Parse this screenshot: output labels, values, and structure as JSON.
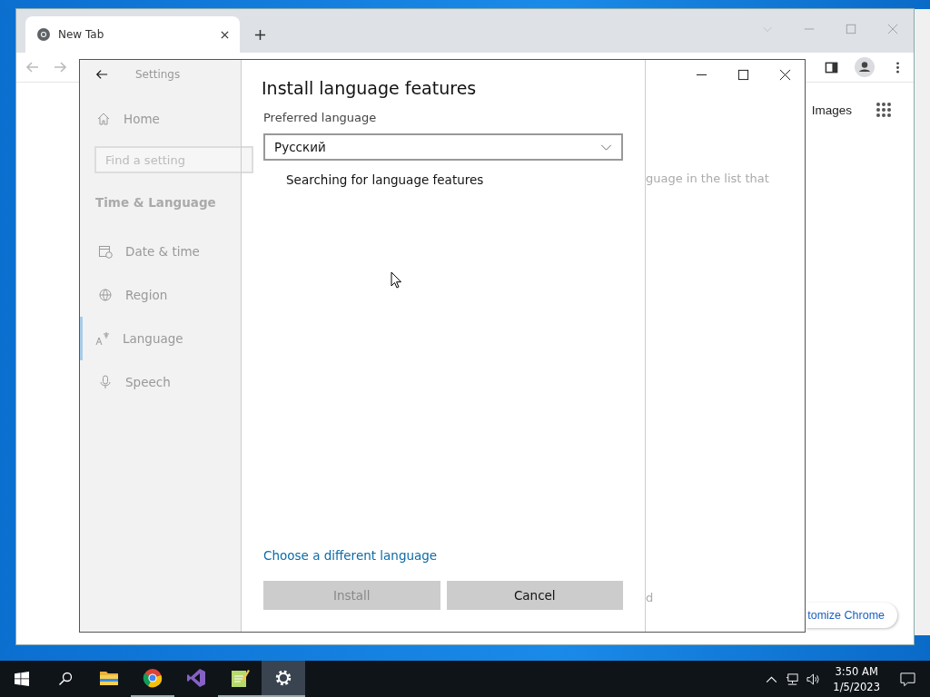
{
  "browser": {
    "tab": {
      "title": "New Tab"
    },
    "page": {
      "images_link": "Images",
      "customize_button": "tomize Chrome"
    }
  },
  "settings": {
    "title": "Settings",
    "home": "Home",
    "search": {
      "placeholder": "Find a setting"
    },
    "section": "Time & Language",
    "nav": [
      {
        "label": "Date & time",
        "selected": false
      },
      {
        "label": "Region",
        "selected": false
      },
      {
        "label": "Language",
        "selected": true
      },
      {
        "label": "Speech",
        "selected": false
      }
    ],
    "background_text": [
      "guage in the list that",
      "d"
    ]
  },
  "dialog": {
    "title": "Install language features",
    "field_label": "Preferred language",
    "language": {
      "value": "Русский"
    },
    "status": "Searching for language features",
    "link": "Choose a different language",
    "buttons": [
      {
        "label": "Install",
        "disabled": true
      },
      {
        "label": "Cancel",
        "disabled": false
      }
    ]
  },
  "taskbar": {
    "apps": [
      {
        "open": false,
        "active": false
      },
      {
        "open": true,
        "active": false
      },
      {
        "open": false,
        "active": false
      },
      {
        "open": true,
        "active": false
      },
      {
        "open": true,
        "active": true
      }
    ],
    "time": "3:50 AM",
    "date": "1/5/2023"
  }
}
